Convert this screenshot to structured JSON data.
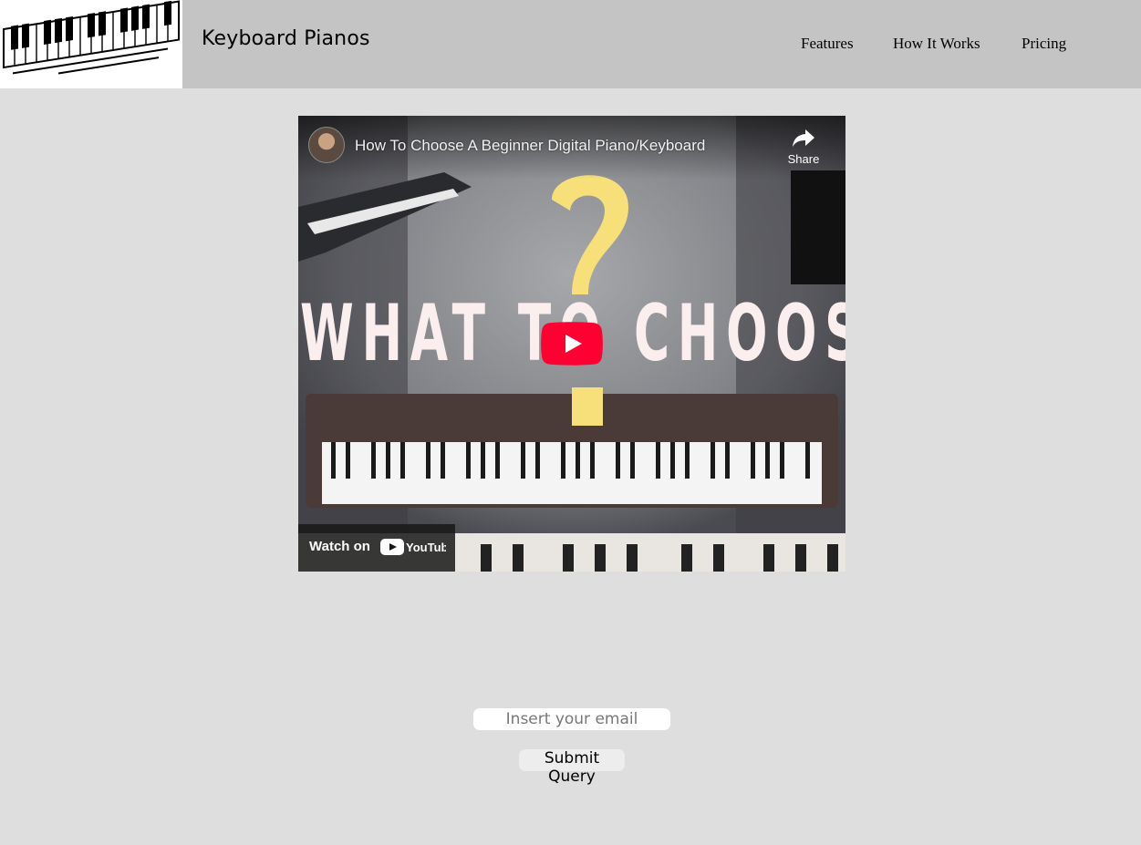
{
  "header": {
    "brand": "Keyboard Pianos",
    "logo_icon": "piano-keys-logo",
    "nav": [
      {
        "label": "Features"
      },
      {
        "label": "How It Works"
      },
      {
        "label": "Pricing"
      }
    ]
  },
  "video": {
    "title": "How To Choose A Beginner Digital Piano/Keyboard",
    "share_label": "Share",
    "thumbnail_text_left": "WHAT TO",
    "thumbnail_text_right": "CHOOSE",
    "watch_on_label": "Watch on",
    "platform": "YouTube",
    "play_button_color": "#ff0000",
    "question_mark_color": "#f7e07a"
  },
  "form": {
    "email_placeholder": "Insert your email",
    "submit_label": "Submit Query"
  },
  "colors": {
    "header_bg": "#c4c4c4",
    "page_bg": "#dedede"
  }
}
